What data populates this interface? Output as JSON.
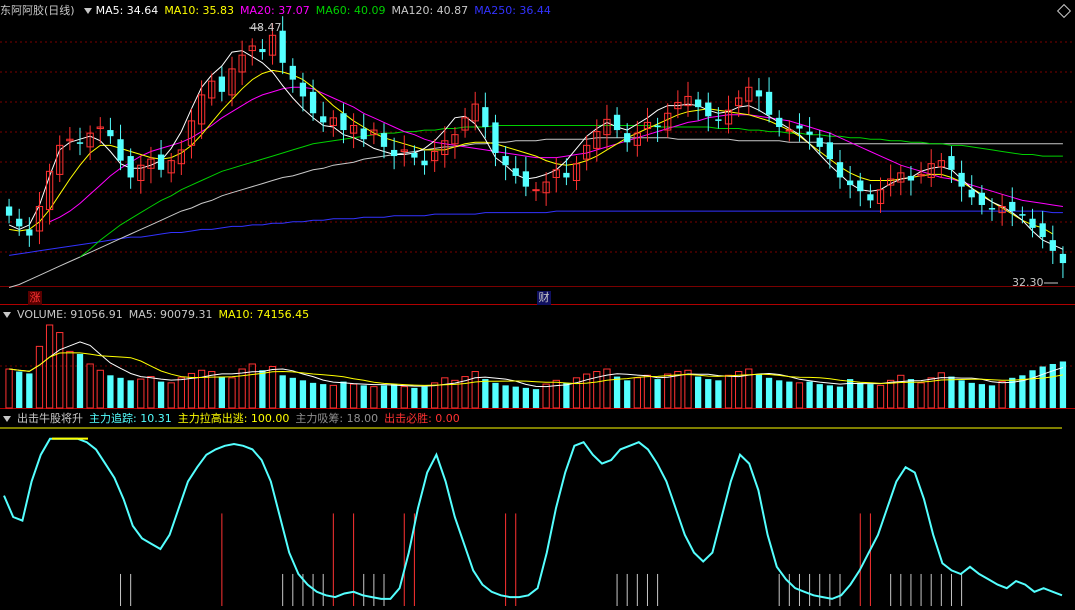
{
  "main_header": {
    "title": "东阿阿胶(日线)",
    "ma5": "MA5: 34.64",
    "ma10": "MA10: 35.83",
    "ma20": "MA20: 37.07",
    "ma60": "MA60: 40.09",
    "ma120": "MA120: 40.87",
    "ma250": "MA250: 36.44"
  },
  "colors": {
    "up": "#ff3232",
    "down": "#54ffff",
    "ma5": "#ffffff",
    "ma10": "#ffff00",
    "ma20": "#ff00ff",
    "ma60": "#00d000",
    "ma120": "#c8c8c8",
    "ma250": "#3232ff",
    "grid": "#7a0000",
    "text": "#c8c8c8"
  },
  "price_labels": {
    "high": "48.47",
    "low": "32.30"
  },
  "markers": {
    "zhang": "涨",
    "cai": "财"
  },
  "volume_header": {
    "label": "VOLUME: 91056.91",
    "ma5": "MA5: 90079.31",
    "ma10": "MA10: 74156.45"
  },
  "indicator_header": {
    "name": "出击牛股将升",
    "s1": "主力追踪: 10.31",
    "s2": "主力拉高出逃: 100.00",
    "s3": "主力吸筹: 18.00",
    "s4": "出击必胜: 0.00"
  },
  "chart_data": {
    "type": "candlestick",
    "series_closes": [
      36.2,
      35.5,
      34.9,
      36.8,
      39.1,
      40.8,
      41.2,
      40.9,
      41.6,
      42.0,
      41.4,
      39.8,
      38.7,
      39.5,
      39.9,
      39.2,
      39.8,
      40.5,
      42.4,
      44.1,
      45.0,
      44.3,
      45.8,
      46.7,
      47.3,
      46.9,
      48.0,
      46.2,
      45.1,
      44.0,
      42.9,
      42.3,
      42.6,
      41.8,
      42.1,
      41.2,
      41.8,
      40.7,
      40.1,
      40.5,
      40.0,
      39.5,
      40.4,
      41.1,
      41.5,
      42.6,
      43.5,
      42.0,
      40.3,
      39.5,
      38.8,
      38.1,
      37.9,
      38.4,
      39.2,
      38.7,
      39.6,
      40.8,
      41.7,
      42.5,
      41.8,
      41.0,
      41.6,
      42.3,
      42.0,
      42.9,
      43.6,
      44.0,
      43.3,
      42.7,
      42.4,
      43.1,
      43.9,
      44.6,
      44.0,
      42.8,
      42.0,
      41.8,
      41.9,
      41.5,
      40.7,
      39.9,
      38.7,
      38.2,
      37.8,
      37.2,
      37.9,
      38.6,
      39.0,
      38.5,
      38.9,
      39.6,
      39.8,
      39.2,
      38.1,
      37.4,
      36.9,
      36.6,
      36.8,
      36.5,
      36.2,
      35.4,
      34.8,
      33.9,
      33.1
    ],
    "volume": [
      62,
      58,
      55,
      98,
      132,
      120,
      90,
      86,
      70,
      60,
      52,
      48,
      44,
      46,
      50,
      42,
      40,
      48,
      55,
      60,
      58,
      50,
      48,
      62,
      70,
      60,
      66,
      52,
      48,
      44,
      40,
      38,
      36,
      42,
      38,
      36,
      34,
      36,
      38,
      34,
      32,
      34,
      40,
      48,
      44,
      50,
      58,
      46,
      40,
      36,
      34,
      32,
      30,
      38,
      44,
      40,
      48,
      54,
      58,
      62,
      50,
      44,
      48,
      52,
      46,
      54,
      58,
      60,
      50,
      46,
      44,
      52,
      58,
      62,
      54,
      48,
      44,
      42,
      40,
      42,
      38,
      36,
      34,
      46,
      40,
      38,
      36,
      44,
      52,
      46,
      40,
      48,
      56,
      50,
      44,
      40,
      38,
      36,
      42,
      48,
      52,
      60,
      66,
      70,
      74
    ],
    "indicator": [
      62,
      50,
      48,
      70,
      85,
      94,
      94,
      94,
      94,
      92,
      88,
      80,
      72,
      60,
      45,
      38,
      35,
      32,
      40,
      55,
      70,
      78,
      85,
      88,
      90,
      91,
      90,
      88,
      82,
      70,
      50,
      30,
      18,
      12,
      8,
      6,
      5,
      7,
      8,
      6,
      5,
      4,
      4,
      10,
      30,
      55,
      75,
      85,
      70,
      50,
      35,
      20,
      12,
      8,
      6,
      5,
      5,
      6,
      10,
      30,
      55,
      75,
      90,
      92,
      85,
      80,
      82,
      88,
      90,
      92,
      88,
      80,
      70,
      55,
      40,
      30,
      25,
      30,
      50,
      70,
      85,
      80,
      65,
      40,
      22,
      15,
      10,
      8,
      6,
      5,
      4,
      6,
      12,
      20,
      30,
      40,
      55,
      70,
      78,
      75,
      60,
      40,
      24,
      20,
      18,
      22,
      18,
      15,
      12,
      10,
      14,
      12,
      8,
      10,
      8,
      6
    ],
    "ma5": [
      35.6,
      35.3,
      35.6,
      36.9,
      38.8,
      40.5,
      41.0,
      41.2,
      41.4,
      41.1,
      40.4,
      39.6,
      39.3,
      39.3,
      39.5,
      39.8,
      40.6,
      41.7,
      43.2,
      44.6,
      45.4,
      46.0,
      46.9,
      47.0,
      46.6,
      46.2,
      45.6,
      44.7,
      43.9,
      43.2,
      42.6,
      42.1,
      42.0,
      41.5,
      41.3,
      41.0,
      40.6,
      40.4,
      40.2,
      40.2,
      40.3,
      40.6,
      41.1,
      41.8,
      42.6,
      42.7,
      42.2,
      41.2,
      40.0,
      39.5,
      38.9,
      38.6,
      38.7,
      38.9,
      39.2,
      39.8,
      40.6,
      41.4,
      41.9,
      42.3,
      42.0,
      41.8,
      42.2,
      42.6,
      43.1,
      43.4,
      43.4,
      43.5,
      43.4,
      43.1,
      42.9,
      43.0,
      43.3,
      43.4,
      43.1,
      42.7,
      42.3,
      41.9,
      41.5,
      40.9,
      40.2,
      39.5,
      38.9,
      38.3,
      37.9,
      37.8,
      37.9,
      38.3,
      38.6,
      38.7,
      39.1,
      39.3,
      39.4,
      39.2,
      38.6,
      38.0,
      37.5,
      37.1,
      36.8,
      36.4,
      35.9,
      35.2,
      34.6,
      34.3,
      34.0
    ],
    "ma10": [
      35.3,
      35.2,
      35.3,
      35.8,
      36.6,
      37.6,
      38.6,
      39.5,
      40.3,
      40.8,
      40.8,
      40.6,
      40.4,
      40.2,
      40.0,
      39.9,
      40.0,
      40.3,
      40.8,
      41.5,
      42.3,
      43.1,
      43.8,
      44.5,
      45.1,
      45.5,
      45.7,
      45.6,
      45.4,
      45.1,
      44.6,
      44.0,
      43.4,
      42.9,
      42.4,
      42.0,
      41.6,
      41.3,
      41.1,
      40.9,
      40.7,
      40.5,
      40.5,
      40.5,
      40.7,
      40.9,
      41.0,
      41.0,
      40.9,
      40.7,
      40.5,
      40.3,
      40.1,
      39.8,
      39.6,
      39.5,
      39.6,
      39.8,
      40.1,
      40.5,
      40.9,
      41.3,
      41.6,
      41.9,
      42.2,
      42.5,
      42.8,
      43.0,
      43.1,
      43.2,
      43.1,
      43.0,
      42.9,
      42.8,
      42.6,
      42.4,
      42.1,
      41.8,
      41.4,
      40.9,
      40.4,
      39.9,
      39.4,
      39.0,
      38.7,
      38.5,
      38.5,
      38.5,
      38.6,
      38.7,
      38.8,
      38.9,
      38.9,
      38.7,
      38.4,
      38.0,
      37.6,
      37.1,
      36.7,
      36.3,
      35.9,
      35.6,
      35.4,
      35.0
    ],
    "ma20": [
      null,
      null,
      null,
      null,
      35.8,
      36.1,
      36.5,
      37.0,
      37.6,
      38.2,
      38.8,
      39.3,
      39.7,
      40.1,
      40.4,
      40.6,
      40.8,
      41.0,
      41.3,
      41.7,
      42.1,
      42.6,
      43.0,
      43.4,
      43.8,
      44.1,
      44.3,
      44.5,
      44.6,
      44.6,
      44.5,
      44.2,
      43.9,
      43.6,
      43.3,
      42.9,
      42.6,
      42.3,
      42.0,
      41.7,
      41.5,
      41.2,
      41.0,
      40.9,
      40.8,
      40.7,
      40.6,
      40.5,
      40.4,
      40.3,
      40.2,
      40.1,
      40.0,
      40.0,
      40.0,
      40.1,
      40.2,
      40.3,
      40.5,
      40.7,
      40.9,
      41.1,
      41.3,
      41.5,
      41.7,
      41.9,
      42.1,
      42.3,
      42.4,
      42.6,
      42.7,
      42.8,
      42.8,
      42.8,
      42.7,
      42.6,
      42.5,
      42.4,
      42.2,
      42.0,
      41.8,
      41.6,
      41.3,
      41.0,
      40.7,
      40.4,
      40.1,
      39.8,
      39.5,
      39.3,
      39.1,
      38.9,
      38.7,
      38.6,
      38.4,
      38.2,
      38.0,
      37.8,
      37.6,
      37.4,
      37.2,
      37.1,
      37.0,
      36.9,
      36.8
    ],
    "ma60": [
      null,
      null,
      null,
      null,
      null,
      null,
      null,
      33.5,
      34.0,
      34.6,
      35.1,
      35.6,
      36.0,
      36.4,
      36.8,
      37.2,
      37.5,
      37.9,
      38.2,
      38.5,
      38.8,
      39.1,
      39.3,
      39.5,
      39.7,
      39.9,
      40.1,
      40.3,
      40.5,
      40.7,
      40.9,
      41.0,
      41.1,
      41.2,
      41.3,
      41.4,
      41.5,
      41.6,
      41.6,
      41.7,
      41.7,
      41.8,
      41.8,
      41.9,
      41.9,
      42.0,
      42.0,
      42.0,
      42.1,
      42.1,
      42.1,
      42.1,
      42.1,
      42.1,
      42.1,
      42.1,
      42.1,
      42.1,
      42.1,
      42.1,
      42.1,
      42.1,
      42.1,
      42.1,
      42.0,
      42.0,
      42.0,
      42.0,
      42.0,
      42.0,
      41.9,
      41.9,
      41.9,
      41.8,
      41.8,
      41.7,
      41.7,
      41.6,
      41.6,
      41.5,
      41.5,
      41.4,
      41.4,
      41.3,
      41.3,
      41.2,
      41.2,
      41.1,
      41.1,
      41.0,
      41.0,
      40.9,
      40.9,
      40.8,
      40.8,
      40.7,
      40.6,
      40.5,
      40.4,
      40.3,
      40.2,
      40.2,
      40.1,
      40.1,
      40.1
    ],
    "ma120": [
      31.5,
      31.7,
      32.0,
      32.3,
      32.6,
      32.9,
      33.2,
      33.5,
      33.8,
      34.1,
      34.4,
      34.7,
      35.0,
      35.3,
      35.6,
      35.9,
      36.2,
      36.5,
      36.7,
      37.0,
      37.2,
      37.5,
      37.7,
      37.9,
      38.1,
      38.3,
      38.5,
      38.7,
      38.8,
      39.0,
      39.2,
      39.3,
      39.5,
      39.6,
      39.7,
      39.9,
      40.0,
      40.1,
      40.2,
      40.3,
      40.4,
      40.5,
      40.6,
      40.7,
      40.7,
      40.8,
      40.9,
      40.9,
      41.0,
      41.0,
      41.1,
      41.1,
      41.1,
      41.2,
      41.2,
      41.2,
      41.2,
      41.2,
      41.3,
      41.3,
      41.3,
      41.3,
      41.3,
      41.3,
      41.3,
      41.3,
      41.2,
      41.2,
      41.2,
      41.2,
      41.2,
      41.2,
      41.1,
      41.1,
      41.1,
      41.1,
      41.1,
      41.0,
      41.0,
      41.0,
      41.0,
      40.9,
      40.9,
      40.9,
      40.9,
      40.9,
      40.9,
      40.9,
      40.9,
      40.9,
      40.9,
      40.9,
      40.9,
      40.9,
      40.9,
      40.9,
      40.9,
      40.9,
      40.9,
      40.9,
      40.9,
      40.9,
      40.9,
      40.9,
      40.9
    ],
    "ma250": [
      33.6,
      33.7,
      33.8,
      33.9,
      34.0,
      34.1,
      34.2,
      34.3,
      34.4,
      34.5,
      34.6,
      34.7,
      34.8,
      34.8,
      34.9,
      35.0,
      35.1,
      35.1,
      35.2,
      35.3,
      35.3,
      35.4,
      35.5,
      35.5,
      35.6,
      35.6,
      35.7,
      35.7,
      35.8,
      35.8,
      35.9,
      35.9,
      36.0,
      36.0,
      36.0,
      36.1,
      36.1,
      36.1,
      36.2,
      36.2,
      36.2,
      36.2,
      36.3,
      36.3,
      36.3,
      36.3,
      36.3,
      36.4,
      36.4,
      36.4,
      36.4,
      36.4,
      36.4,
      36.4,
      36.5,
      36.5,
      36.5,
      36.5,
      36.5,
      36.5,
      36.5,
      36.5,
      36.5,
      36.5,
      36.5,
      36.5,
      36.5,
      36.5,
      36.5,
      36.5,
      36.5,
      36.5,
      36.5,
      36.5,
      36.5,
      36.5,
      36.5,
      36.5,
      36.5,
      36.5,
      36.5,
      36.5,
      36.5,
      36.5,
      36.5,
      36.5,
      36.5,
      36.5,
      36.5,
      36.5,
      36.5,
      36.5,
      36.5,
      36.5,
      36.5,
      36.5,
      36.5,
      36.5,
      36.5,
      36.5,
      36.5,
      36.5,
      36.5,
      36.4,
      36.4
    ],
    "price_range": [
      31.6,
      49.0
    ],
    "signal_red_bars": [
      21,
      32,
      34,
      39,
      40,
      49,
      50,
      84,
      85
    ],
    "signal_white_bars": [
      11,
      12,
      27,
      28,
      29,
      30,
      31,
      35,
      36,
      37,
      60,
      61,
      62,
      63,
      64,
      76,
      77,
      78,
      79,
      80,
      81,
      82,
      87,
      88,
      89,
      90,
      91,
      92,
      93,
      94
    ]
  }
}
